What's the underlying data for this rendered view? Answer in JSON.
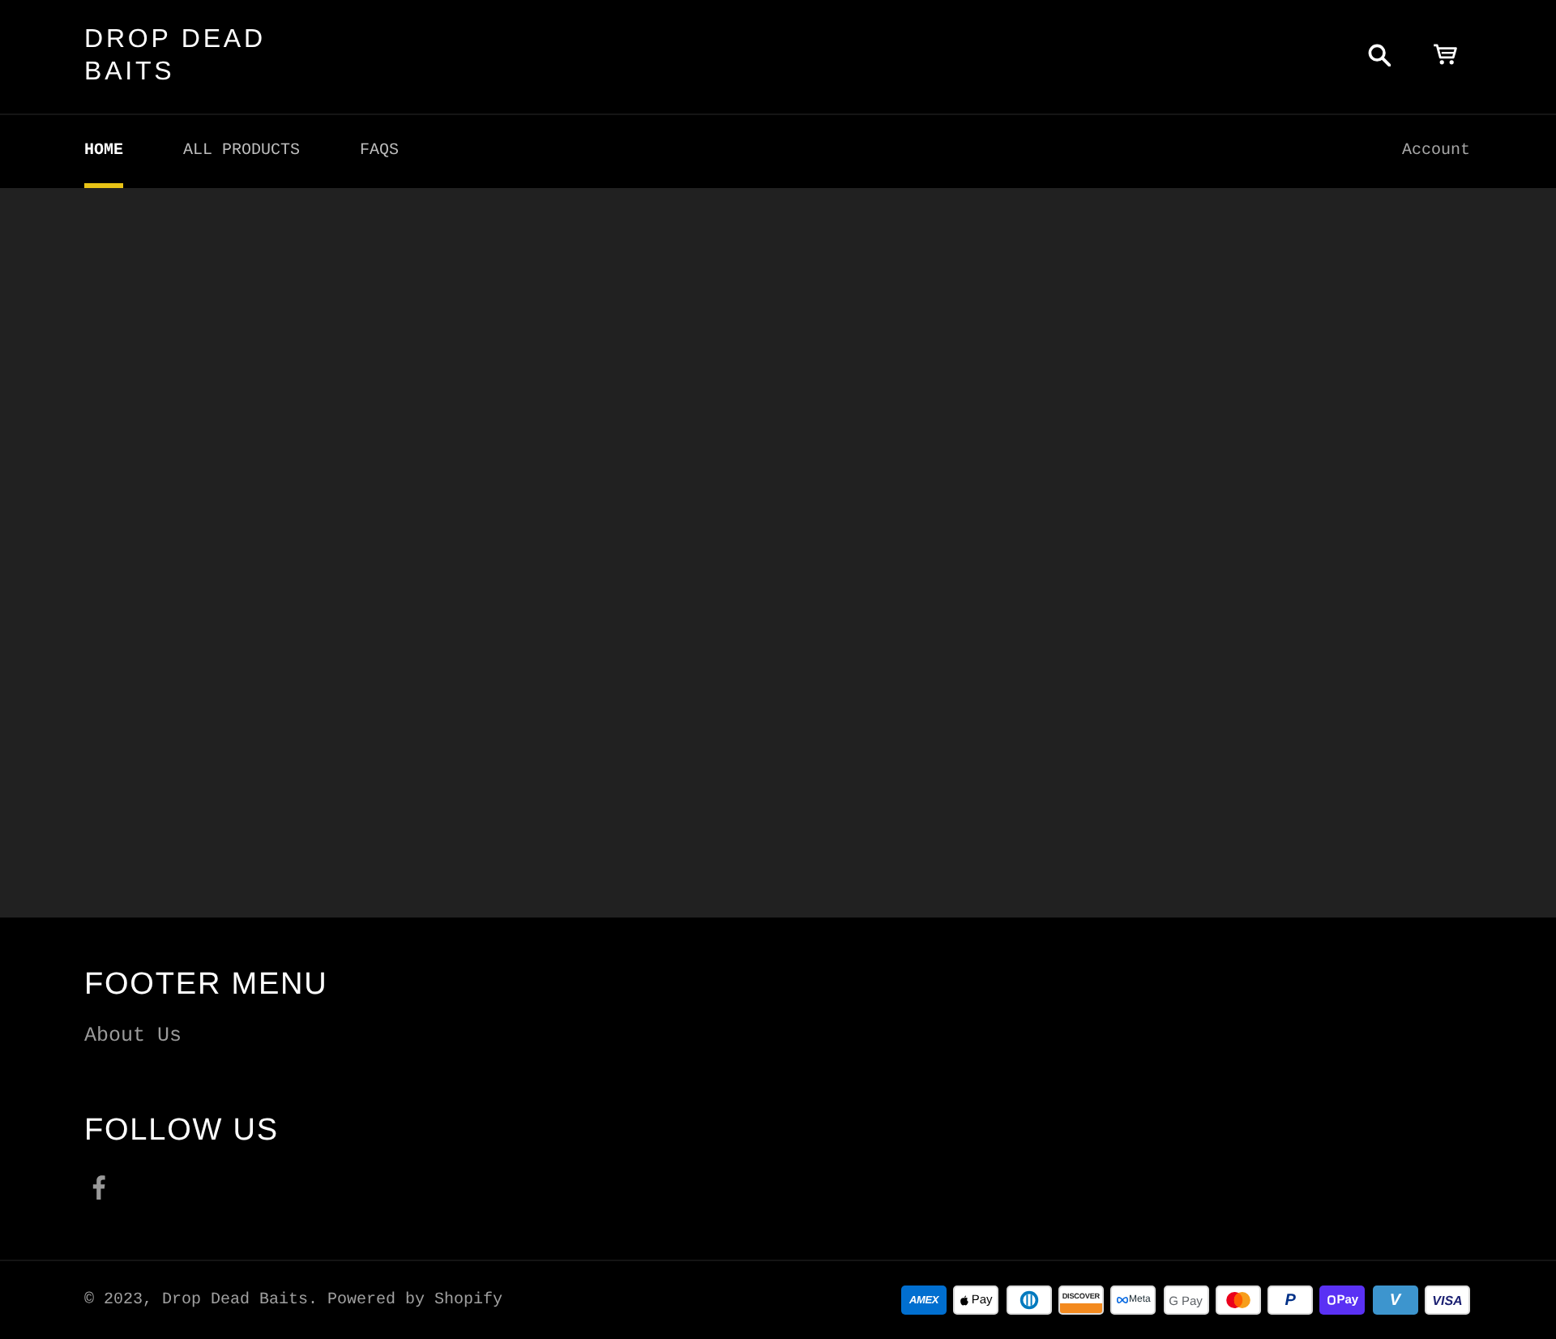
{
  "header": {
    "logo": "DROP DEAD BAITS"
  },
  "nav": {
    "items": [
      {
        "label": "HOME",
        "selected": true
      },
      {
        "label": "ALL PRODUCTS",
        "selected": false
      },
      {
        "label": "FAQS",
        "selected": false
      }
    ],
    "account": "Account"
  },
  "footer": {
    "menu": {
      "title": "FOOTER MENU",
      "links": [
        "About Us"
      ]
    },
    "social": {
      "title": "FOLLOW US",
      "links": [
        {
          "kind": "facebook"
        }
      ]
    },
    "copyright": "© 2023, Drop Dead Baits. Powered by Shopify",
    "payment_methods": [
      {
        "kind": "amex",
        "label": "AMEX"
      },
      {
        "kind": "apple-pay",
        "label": "Pay"
      },
      {
        "kind": "diners"
      },
      {
        "kind": "discover",
        "label": "DISCOVER"
      },
      {
        "kind": "meta-pay",
        "label": "Meta"
      },
      {
        "kind": "google-pay",
        "label": "G Pay"
      },
      {
        "kind": "mastercard"
      },
      {
        "kind": "paypal",
        "label": "P"
      },
      {
        "kind": "shop-pay",
        "label": "Pay"
      },
      {
        "kind": "venmo",
        "label": "V"
      },
      {
        "kind": "visa",
        "label": "VISA"
      }
    ]
  }
}
